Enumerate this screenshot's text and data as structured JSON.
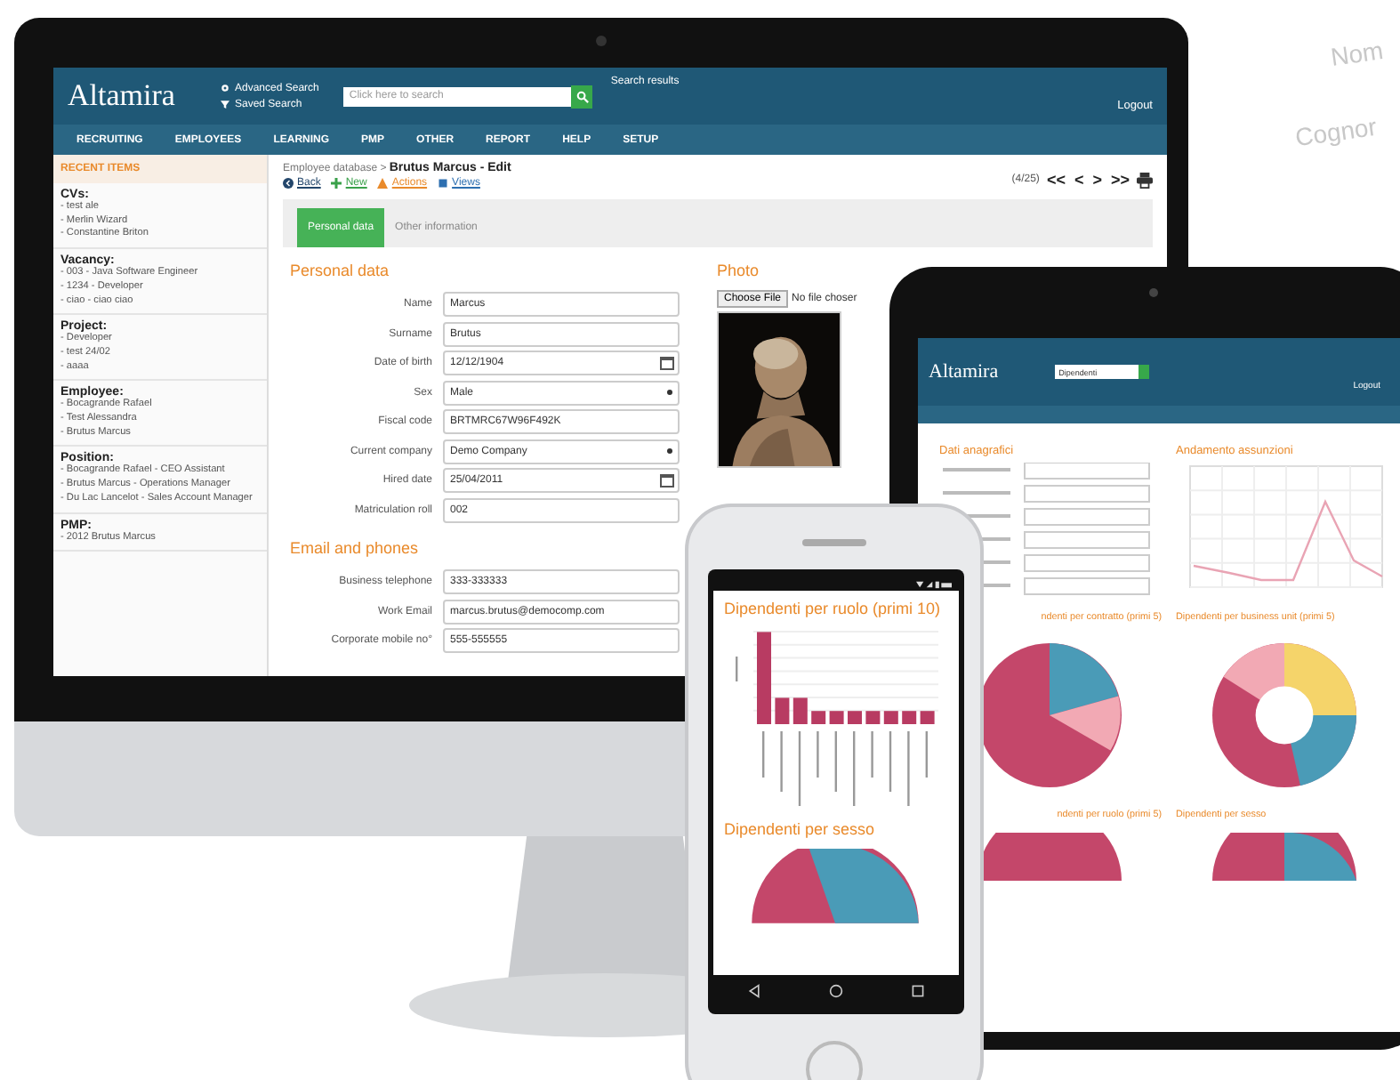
{
  "background_labels": [
    "Nom",
    "Cognor"
  ],
  "desktop": {
    "logo": "Altamira",
    "header_links": [
      {
        "label": "Advanced Search",
        "kind": "gear"
      },
      {
        "label": "Saved Search",
        "kind": "filter"
      }
    ],
    "search": {
      "placeholder": "Click here to search"
    },
    "search_results": "Search results",
    "logout": "Logout",
    "nav": [
      "RECRUITING",
      "EMPLOYEES",
      "LEARNING",
      "PMP",
      "OTHER",
      "REPORT",
      "HELP",
      "SETUP"
    ],
    "recent_title": "RECENT ITEMS",
    "sidebar_sections": [
      {
        "title": "CVs:",
        "items": [
          "- test ale",
          "- Merlin Wizard",
          "- Constantine Briton"
        ]
      },
      {
        "title": "Vacancy:",
        "items": [
          "- 003 - Java Software Engineer",
          "- 1234 - Developer",
          "- ciao - ciao ciao"
        ]
      },
      {
        "title": "Project:",
        "items": [
          "- Developer",
          "- test 24/02",
          "- aaaa"
        ]
      },
      {
        "title": "Employee:",
        "items": [
          "- Bocagrande Rafael",
          "- Test Alessandra",
          "- Brutus Marcus"
        ]
      },
      {
        "title": "Position:",
        "items": [
          "- Bocagrande Rafael - CEO Assistant",
          "- Brutus Marcus - Operations Manager",
          "- Du Lac Lancelot - Sales Account Manager"
        ]
      },
      {
        "title": "PMP:",
        "items": [
          "- 2012 Brutus Marcus"
        ]
      }
    ],
    "breadcrumb": {
      "path": "Employee database >",
      "current": "Brutus Marcus - Edit"
    },
    "actions": [
      {
        "label": "Back",
        "kind": "back"
      },
      {
        "label": "New",
        "kind": "new"
      },
      {
        "label": "Actions",
        "kind": "warn"
      },
      {
        "label": "Views",
        "kind": "views"
      }
    ],
    "pager": {
      "position": "(4/25)",
      "buttons": [
        "<<",
        "<",
        ">",
        ">>"
      ]
    },
    "tabs": [
      {
        "label": "Personal data",
        "selected": true
      },
      {
        "label": "Other information",
        "selected": false
      }
    ],
    "personal_title": "Personal data",
    "fields": [
      {
        "label": "Name",
        "value": "Marcus",
        "kind": "text"
      },
      {
        "label": "Surname",
        "value": "Brutus",
        "kind": "text"
      },
      {
        "label": "Date of birth",
        "value": "12/12/1904",
        "kind": "date"
      },
      {
        "label": "Sex",
        "value": "Male",
        "kind": "select"
      },
      {
        "label": "Fiscal code",
        "value": "BRTMRC67W96F492K",
        "kind": "text"
      },
      {
        "label": "Current company",
        "value": "Demo Company",
        "kind": "select"
      },
      {
        "label": "Hired date",
        "value": "25/04/2011",
        "kind": "date"
      },
      {
        "label": "Matriculation roll",
        "value": "002",
        "kind": "text"
      }
    ],
    "photo": {
      "title": "Photo",
      "button": "Choose File",
      "status": "No file choser"
    },
    "email_title": "Email and phones",
    "email_fields": [
      {
        "label": "Business telephone",
        "value": "333-333333"
      },
      {
        "label": "Work Email",
        "value": "marcus.brutus@democomp.com"
      },
      {
        "label": "Corporate mobile no°",
        "value": "555-555555"
      }
    ]
  },
  "tablet": {
    "logo": "Altamira",
    "search_value": "Dipendenti",
    "logout": "Logout",
    "titles": [
      "Dati anagrafici",
      "Andamento assunzioni"
    ],
    "lower_titles": [
      "ndenti per contratto (primi 5)",
      "Dipendenti per business unit (primi 5)",
      "ndenti per ruolo (primi 5)",
      "Dipendenti per sesso"
    ]
  },
  "phone": {
    "titles": [
      "Dipendenti per ruolo (primi 10)",
      "Dipendenti per sesso"
    ]
  }
}
